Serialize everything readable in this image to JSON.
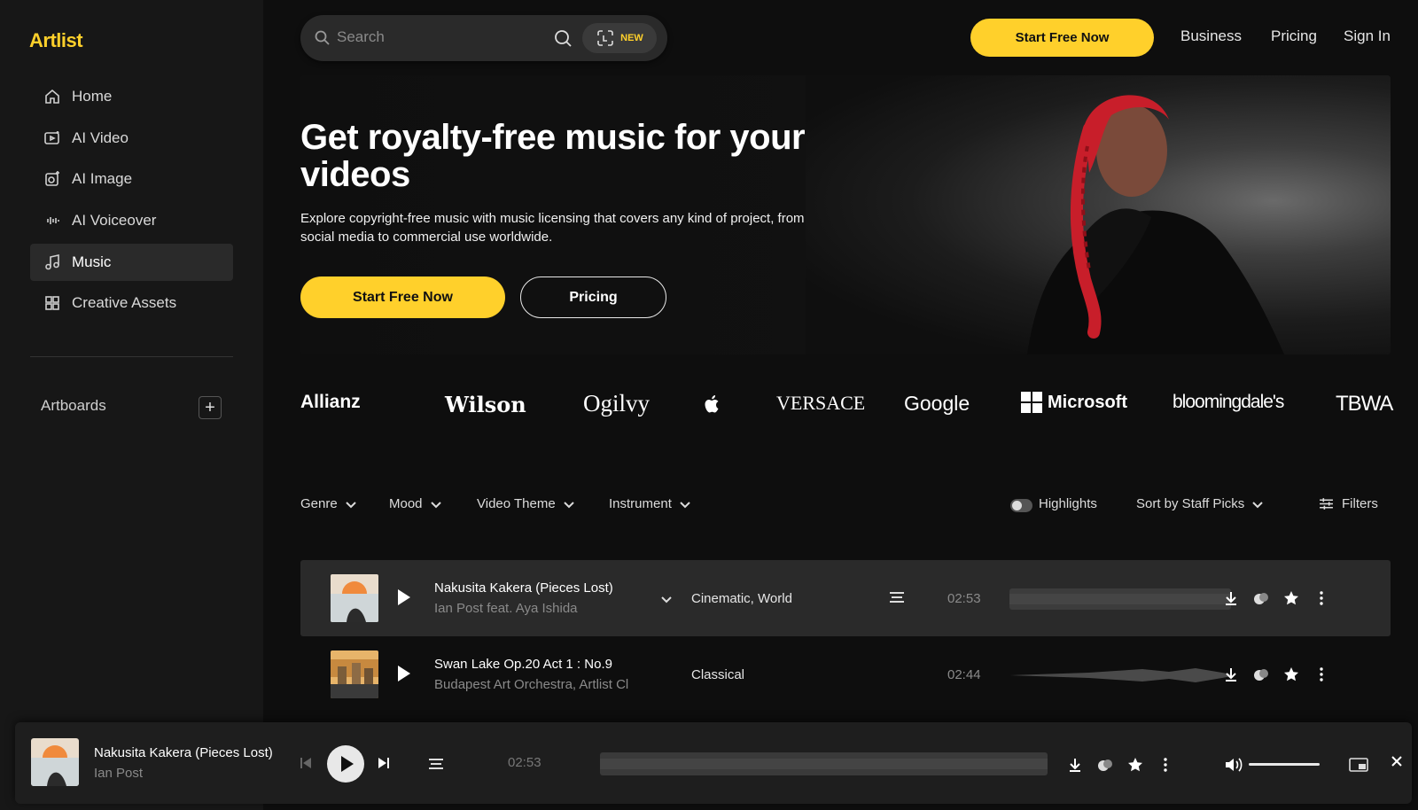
{
  "brand": {
    "logo": "Artlist",
    "accent": "#ffd02b"
  },
  "sidebar": {
    "items": [
      {
        "label": "Home",
        "icon": "home-icon"
      },
      {
        "label": "AI Video",
        "icon": "ai-video-icon"
      },
      {
        "label": "AI Image",
        "icon": "ai-image-icon"
      },
      {
        "label": "AI Voiceover",
        "icon": "voiceover-icon"
      },
      {
        "label": "Music",
        "icon": "music-note-icon",
        "active": true
      },
      {
        "label": "Creative Assets",
        "icon": "grid-icon"
      }
    ],
    "artboards_label": "Artboards",
    "add_label": "+"
  },
  "header": {
    "search_placeholder": "Search",
    "new_badge": "NEW",
    "cta": "Start Free Now",
    "links": [
      "Business",
      "Pricing",
      "Sign In"
    ]
  },
  "hero": {
    "title": "Get royalty-free music for your videos",
    "subtitle": "Explore copyright-free music with music licensing that covers any kind of project, from social media to commercial use worldwide.",
    "primary": "Start Free Now",
    "secondary": "Pricing"
  },
  "brands": [
    "Allianz",
    "Wilson",
    "Ogilvy",
    "",
    "VERSACE",
    "Google",
    "Microsoft",
    "bloomingdale's",
    "TBWA"
  ],
  "filters": {
    "genre": "Genre",
    "mood": "Mood",
    "video_theme": "Video Theme",
    "instrument": "Instrument",
    "highlights": "Highlights",
    "sort": "Sort by Staff Picks",
    "filters": "Filters"
  },
  "tracks": [
    {
      "title": "Nakusita Kakera (Pieces Lost)",
      "artist": "Ian Post feat. Aya Ishida",
      "genre": "Cinematic, World",
      "duration": "02:53"
    },
    {
      "title": "Swan Lake Op.20 Act 1 : No.9",
      "artist": "Budapest Art Orchestra, Artlist Cl",
      "genre": "Classical",
      "duration": "02:44"
    }
  ],
  "player": {
    "title": "Nakusita Kakera (Pieces Lost)",
    "artist": "Ian Post",
    "duration": "02:53",
    "volume": 1.0
  }
}
